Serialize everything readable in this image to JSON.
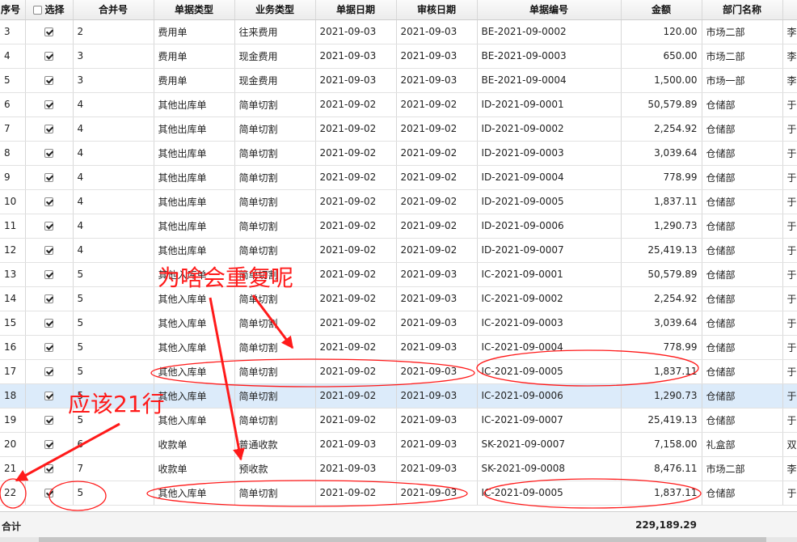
{
  "columns": [
    "序号",
    "选择",
    "合并号",
    "单据类型",
    "业务类型",
    "单据日期",
    "审核日期",
    "单据编号",
    "金额",
    "部门名称",
    ""
  ],
  "rows": [
    {
      "seq": "3",
      "checked": true,
      "merge": "2",
      "doc_type": "费用单",
      "biz_type": "往来费用",
      "doc_date": "2021-09-03",
      "audit_date": "2021-09-03",
      "doc_no": "BE-2021-09-0002",
      "amount": "120.00",
      "dept": "市场二部",
      "extra": "李"
    },
    {
      "seq": "4",
      "checked": true,
      "merge": "3",
      "doc_type": "费用单",
      "biz_type": "现金费用",
      "doc_date": "2021-09-03",
      "audit_date": "2021-09-03",
      "doc_no": "BE-2021-09-0003",
      "amount": "650.00",
      "dept": "市场二部",
      "extra": "李"
    },
    {
      "seq": "5",
      "checked": true,
      "merge": "3",
      "doc_type": "费用单",
      "biz_type": "现金费用",
      "doc_date": "2021-09-03",
      "audit_date": "2021-09-03",
      "doc_no": "BE-2021-09-0004",
      "amount": "1,500.00",
      "dept": "市场一部",
      "extra": "李"
    },
    {
      "seq": "6",
      "checked": true,
      "merge": "4",
      "doc_type": "其他出库单",
      "biz_type": "简单切割",
      "doc_date": "2021-09-02",
      "audit_date": "2021-09-02",
      "doc_no": "ID-2021-09-0001",
      "amount": "50,579.89",
      "dept": "仓储部",
      "extra": "于"
    },
    {
      "seq": "7",
      "checked": true,
      "merge": "4",
      "doc_type": "其他出库单",
      "biz_type": "简单切割",
      "doc_date": "2021-09-02",
      "audit_date": "2021-09-02",
      "doc_no": "ID-2021-09-0002",
      "amount": "2,254.92",
      "dept": "仓储部",
      "extra": "于"
    },
    {
      "seq": "8",
      "checked": true,
      "merge": "4",
      "doc_type": "其他出库单",
      "biz_type": "简单切割",
      "doc_date": "2021-09-02",
      "audit_date": "2021-09-02",
      "doc_no": "ID-2021-09-0003",
      "amount": "3,039.64",
      "dept": "仓储部",
      "extra": "于"
    },
    {
      "seq": "9",
      "checked": true,
      "merge": "4",
      "doc_type": "其他出库单",
      "biz_type": "简单切割",
      "doc_date": "2021-09-02",
      "audit_date": "2021-09-02",
      "doc_no": "ID-2021-09-0004",
      "amount": "778.99",
      "dept": "仓储部",
      "extra": "于"
    },
    {
      "seq": "10",
      "checked": true,
      "merge": "4",
      "doc_type": "其他出库单",
      "biz_type": "简单切割",
      "doc_date": "2021-09-02",
      "audit_date": "2021-09-02",
      "doc_no": "ID-2021-09-0005",
      "amount": "1,837.11",
      "dept": "仓储部",
      "extra": "于"
    },
    {
      "seq": "11",
      "checked": true,
      "merge": "4",
      "doc_type": "其他出库单",
      "biz_type": "简单切割",
      "doc_date": "2021-09-02",
      "audit_date": "2021-09-02",
      "doc_no": "ID-2021-09-0006",
      "amount": "1,290.73",
      "dept": "仓储部",
      "extra": "于"
    },
    {
      "seq": "12",
      "checked": true,
      "merge": "4",
      "doc_type": "其他出库单",
      "biz_type": "简单切割",
      "doc_date": "2021-09-02",
      "audit_date": "2021-09-02",
      "doc_no": "ID-2021-09-0007",
      "amount": "25,419.13",
      "dept": "仓储部",
      "extra": "于"
    },
    {
      "seq": "13",
      "checked": true,
      "merge": "5",
      "doc_type": "其他入库单",
      "biz_type": "简单切割",
      "doc_date": "2021-09-02",
      "audit_date": "2021-09-03",
      "doc_no": "IC-2021-09-0001",
      "amount": "50,579.89",
      "dept": "仓储部",
      "extra": "于"
    },
    {
      "seq": "14",
      "checked": true,
      "merge": "5",
      "doc_type": "其他入库单",
      "biz_type": "简单切割",
      "doc_date": "2021-09-02",
      "audit_date": "2021-09-03",
      "doc_no": "IC-2021-09-0002",
      "amount": "2,254.92",
      "dept": "仓储部",
      "extra": "于"
    },
    {
      "seq": "15",
      "checked": true,
      "merge": "5",
      "doc_type": "其他入库单",
      "biz_type": "简单切割",
      "doc_date": "2021-09-02",
      "audit_date": "2021-09-03",
      "doc_no": "IC-2021-09-0003",
      "amount": "3,039.64",
      "dept": "仓储部",
      "extra": "于"
    },
    {
      "seq": "16",
      "checked": true,
      "merge": "5",
      "doc_type": "其他入库单",
      "biz_type": "简单切割",
      "doc_date": "2021-09-02",
      "audit_date": "2021-09-03",
      "doc_no": "IC-2021-09-0004",
      "amount": "778.99",
      "dept": "仓储部",
      "extra": "于"
    },
    {
      "seq": "17",
      "checked": true,
      "merge": "5",
      "doc_type": "其他入库单",
      "biz_type": "简单切割",
      "doc_date": "2021-09-02",
      "audit_date": "2021-09-03",
      "doc_no": "IC-2021-09-0005",
      "amount": "1,837.11",
      "dept": "仓储部",
      "extra": "于"
    },
    {
      "seq": "18",
      "checked": true,
      "merge": "5",
      "doc_type": "其他入库单",
      "biz_type": "简单切割",
      "doc_date": "2021-09-02",
      "audit_date": "2021-09-03",
      "doc_no": "IC-2021-09-0006",
      "amount": "1,290.73",
      "dept": "仓储部",
      "extra": "于",
      "selected": true
    },
    {
      "seq": "19",
      "checked": true,
      "merge": "5",
      "doc_type": "其他入库单",
      "biz_type": "简单切割",
      "doc_date": "2021-09-02",
      "audit_date": "2021-09-03",
      "doc_no": "IC-2021-09-0007",
      "amount": "25,419.13",
      "dept": "仓储部",
      "extra": "于"
    },
    {
      "seq": "20",
      "checked": true,
      "merge": "6",
      "doc_type": "收款单",
      "biz_type": "普通收款",
      "doc_date": "2021-09-03",
      "audit_date": "2021-09-03",
      "doc_no": "SK-2021-09-0007",
      "amount": "7,158.00",
      "dept": "礼盒部",
      "extra": "双"
    },
    {
      "seq": "21",
      "checked": true,
      "merge": "7",
      "doc_type": "收款单",
      "biz_type": "预收款",
      "doc_date": "2021-09-03",
      "audit_date": "2021-09-03",
      "doc_no": "SK-2021-09-0008",
      "amount": "8,476.11",
      "dept": "市场二部",
      "extra": "李"
    },
    {
      "seq": "22",
      "checked": true,
      "merge": "5",
      "doc_type": "其他入库单",
      "biz_type": "简单切割",
      "doc_date": "2021-09-02",
      "audit_date": "2021-09-03",
      "doc_no": "IC-2021-09-0005",
      "amount": "1,837.11",
      "dept": "仓储部",
      "extra": "于"
    }
  ],
  "footer": {
    "label": "合计",
    "total": "229,189.29"
  },
  "annotations": {
    "why_duplicate": "为啥会重复呢",
    "should_be_21": "应该21行",
    "color": "#ff1a1a"
  }
}
